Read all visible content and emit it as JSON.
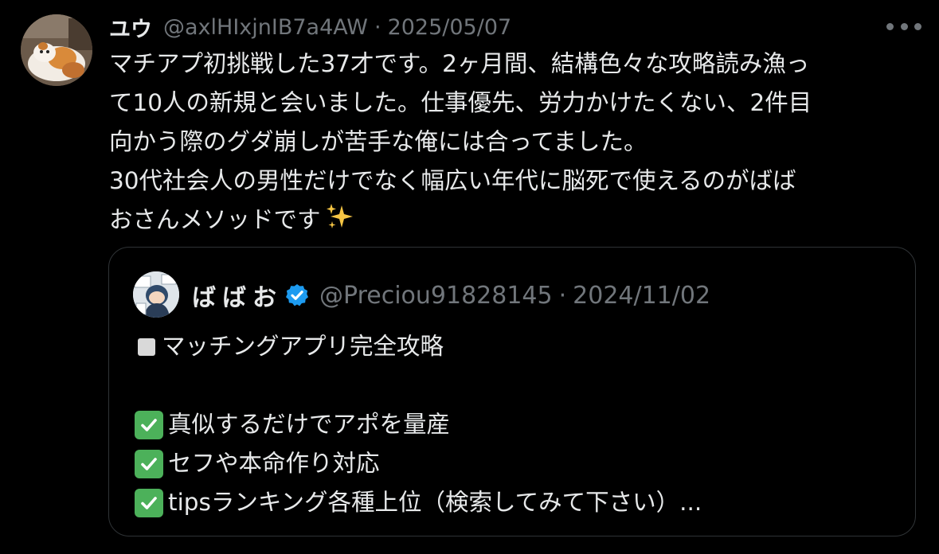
{
  "post": {
    "display_name": "ユウ",
    "handle": "@axlHIxjnIB7a4AW",
    "separator": "·",
    "date": "2025/05/07",
    "more_icon": "more-horizontal-icon",
    "body_lines": [
      "マチアプ初挑戦した37才です。2ヶ月間、結構色々な攻略読み漁っ",
      "て10人の新規と会いました。仕事優先、労力かけたくない、2件目",
      "向かう際のグダ崩しが苦手な俺には合ってました。",
      "30代社会人の男性だけでなく幅広い年代に脳死で使えるのがばば",
      "おさんメソッドです"
    ],
    "trailing_emoji": "sparkles-icon"
  },
  "quote": {
    "display_name": "ばばお",
    "verified_icon": "verified-badge-icon",
    "handle": "@Preciou91828145",
    "separator": "·",
    "date": "2024/11/02",
    "title": "マッチングアプリ完全攻略",
    "items": [
      "真似するだけでアポを量産",
      "セフや本命作り対応",
      "tipsランキング各種上位（検索してみて下さい）..."
    ]
  },
  "colors": {
    "background": "#000000",
    "text_primary": "#e7e9ea",
    "text_secondary": "#71767b",
    "border": "#2f3336",
    "verified_blue": "#1d9bf0",
    "check_green": "#4cb15a"
  }
}
